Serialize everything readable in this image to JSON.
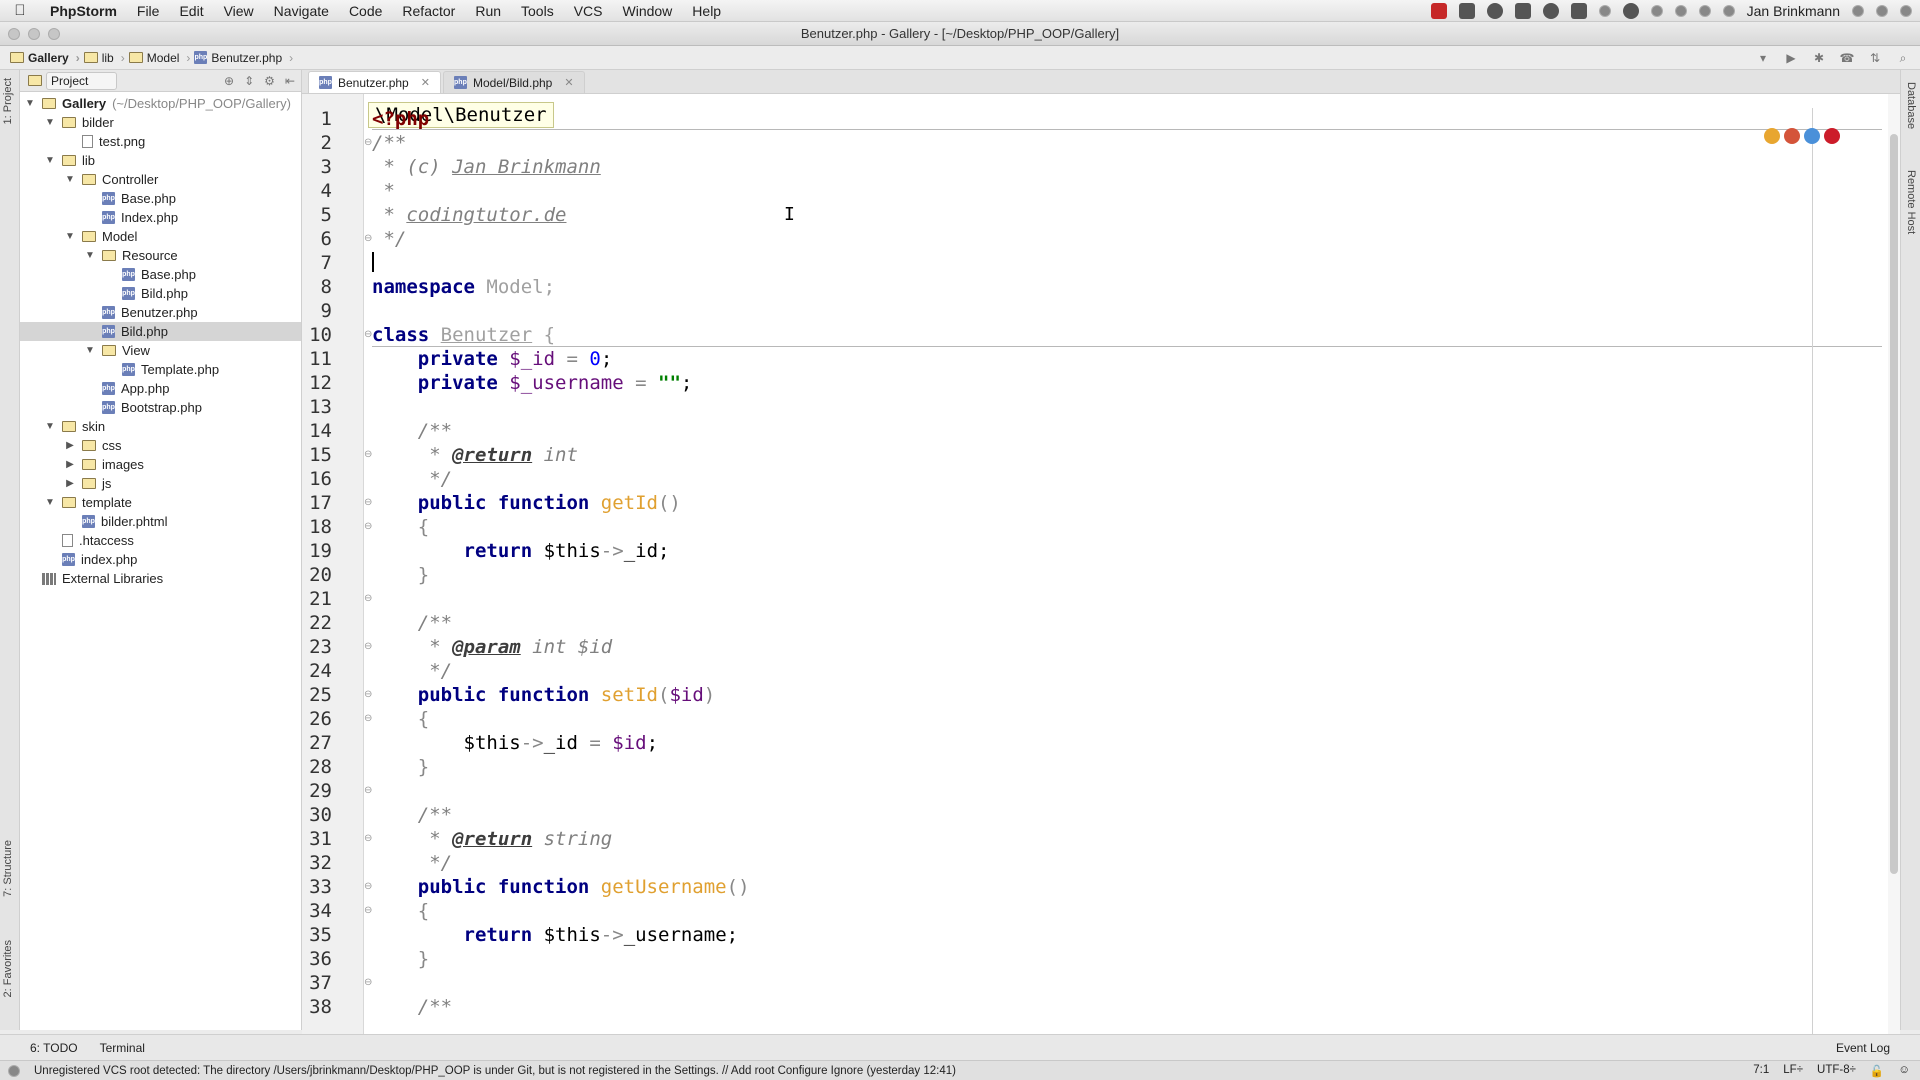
{
  "menubar": {
    "app": "PhpStorm",
    "items": [
      "File",
      "Edit",
      "View",
      "Navigate",
      "Code",
      "Refactor",
      "Run",
      "Tools",
      "VCS",
      "Window",
      "Help"
    ],
    "user": "Jan Brinkmann"
  },
  "window": {
    "title": "Benutzer.php - Gallery - [~/Desktop/PHP_OOP/Gallery]"
  },
  "navbar": {
    "crumbs": [
      "Gallery",
      "lib",
      "Model",
      "Benutzer.php"
    ]
  },
  "project": {
    "header": "Project",
    "tree": [
      {
        "name": "Gallery",
        "extra": "(~/Desktop/PHP_OOP/Gallery)",
        "depth": 0
      },
      {
        "name": "bilder",
        "depth": 1
      },
      {
        "name": "test.png",
        "depth": 2
      },
      {
        "name": "lib",
        "depth": 1
      },
      {
        "name": "Controller",
        "depth": 2
      },
      {
        "name": "Base.php",
        "depth": 3
      },
      {
        "name": "Index.php",
        "depth": 3
      },
      {
        "name": "Model",
        "depth": 2
      },
      {
        "name": "Resource",
        "depth": 3
      },
      {
        "name": "Base.php",
        "depth": 4
      },
      {
        "name": "Bild.php",
        "depth": 4
      },
      {
        "name": "Benutzer.php",
        "depth": 3
      },
      {
        "name": "Bild.php",
        "depth": 3
      },
      {
        "name": "View",
        "depth": 2
      },
      {
        "name": "Template.php",
        "depth": 3
      },
      {
        "name": "App.php",
        "depth": 2
      },
      {
        "name": "Bootstrap.php",
        "depth": 2
      },
      {
        "name": "skin",
        "depth": 1
      },
      {
        "name": "css",
        "depth": 2
      },
      {
        "name": "images",
        "depth": 2
      },
      {
        "name": "js",
        "depth": 2
      },
      {
        "name": "template",
        "depth": 1
      },
      {
        "name": "bilder.phtml",
        "depth": 2
      },
      {
        "name": ".htaccess",
        "depth": 1
      },
      {
        "name": "index.php",
        "depth": 1
      },
      {
        "name": "External Libraries",
        "depth": 0
      }
    ]
  },
  "tabs": [
    {
      "label": "Benutzer.php",
      "active": true
    },
    {
      "label": "Model/Bild.php",
      "active": false
    }
  ],
  "editor": {
    "breadcrumb": "\\Model\\Benutzer",
    "line_numbers": [
      "1",
      "2",
      "3",
      "4",
      "5",
      "6",
      "7",
      "8",
      "9",
      "10",
      "11",
      "12",
      "13",
      "14",
      "15",
      "16",
      "17",
      "18",
      "19",
      "20",
      "21",
      "22",
      "23",
      "24",
      "25",
      "26",
      "27",
      "28",
      "29",
      "30",
      "31",
      "32",
      "33",
      "34",
      "35",
      "36",
      "37",
      "38"
    ],
    "lines": {
      "l1": "<?php",
      "l2": "/**",
      "l3a": " * (c) ",
      "l3b": "Jan Brinkmann",
      "l4": " *",
      "l5a": " * ",
      "l5b": "codingtutor.de",
      "l6": " */",
      "l8a": "namespace",
      "l8b": " Model;",
      "l10a": "class",
      "l10b": "Benutzer",
      "l10c": " {",
      "l11a": "    private",
      "l11b": " $_id",
      "l11c": " = ",
      "l11d": "0",
      "l11e": ";",
      "l12a": "    private",
      "l12b": " $_username",
      "l12c": " = ",
      "l12d": "\"\"",
      "l12e": ";",
      "l14": "    /**",
      "l15a": "     * ",
      "l15b": "@return",
      "l15c": " int",
      "l16": "     */",
      "l17a": "    public function",
      "l17b": " getId",
      "l17c": "()",
      "l18": "    {",
      "l19a": "        return",
      "l19b": " $this",
      "l19c": "->",
      "l19d": "_id",
      "l19e": ";",
      "l20": "    }",
      "l22": "    /**",
      "l23a": "     * ",
      "l23b": "@param",
      "l23c": " int $id",
      "l24": "     */",
      "l25a": "    public function",
      "l25b": " setId",
      "l25c": "(",
      "l25d": "$id",
      "l25e": ")",
      "l26": "    {",
      "l27a": "        $this",
      "l27b": "->",
      "l27c": "_id",
      "l27d": " = ",
      "l27e": "$id",
      "l27f": ";",
      "l28": "    }",
      "l30": "    /**",
      "l31a": "     * ",
      "l31b": "@return",
      "l31c": " string",
      "l32": "     */",
      "l33a": "    public function",
      "l33b": " getUsername",
      "l33c": "()",
      "l34": "    {",
      "l35a": "        return",
      "l35b": " $this",
      "l35c": "->",
      "l35d": "_username",
      "l35e": ";",
      "l36": "    }",
      "l38": "    /**"
    }
  },
  "sidebars": {
    "left": [
      "1: Project",
      "7: Structure",
      "2: Favorites"
    ],
    "right": [
      "Database",
      "Remote Host"
    ]
  },
  "bottom": {
    "todo": "6: TODO",
    "terminal": "Terminal",
    "event_log": "Event Log"
  },
  "status": {
    "message": "Unregistered VCS root detected: The directory /Users/jbrinkmann/Desktop/PHP_OOP is under Git, but is not registered in the Settings. // Add root  Configure  Ignore (yesterday 12:41)",
    "position": "7:1",
    "line_sep": "LF÷",
    "encoding": "UTF-8÷"
  },
  "colors": {
    "keyword": "#000080",
    "php_tag": "#800000",
    "comment": "#808080",
    "function": "#e0a030",
    "selection": "#d5d5d5"
  }
}
